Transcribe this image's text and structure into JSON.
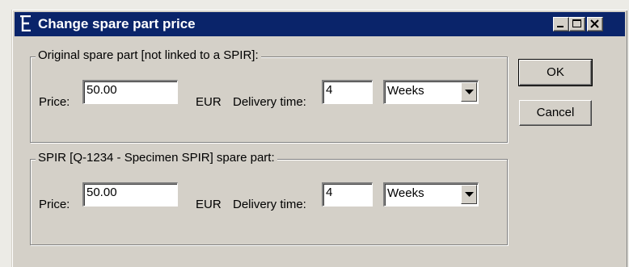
{
  "window": {
    "title": "Change spare part price",
    "controls": {
      "minimize": "minimize",
      "maximize": "maximize",
      "close": "close"
    }
  },
  "original_group": {
    "legend": "Original spare part [not linked to a SPIR]:",
    "price_label": "Price:",
    "price_value": "50.00",
    "currency": "EUR",
    "delivery_label": "Delivery time:",
    "delivery_value": "4",
    "unit_selected": "Weeks"
  },
  "spir_group": {
    "legend": "SPIR [Q-1234 - Specimen SPIR] spare part:",
    "price_label": "Price:",
    "price_value": "50.00",
    "currency": "EUR",
    "delivery_label": "Delivery time:",
    "delivery_value": "4",
    "unit_selected": "Weeks"
  },
  "buttons": {
    "ok": "OK",
    "cancel": "Cancel"
  },
  "colors": {
    "titlebar": "#0a246a",
    "face": "#d4d0c8",
    "desktop": "#ecebe6"
  }
}
